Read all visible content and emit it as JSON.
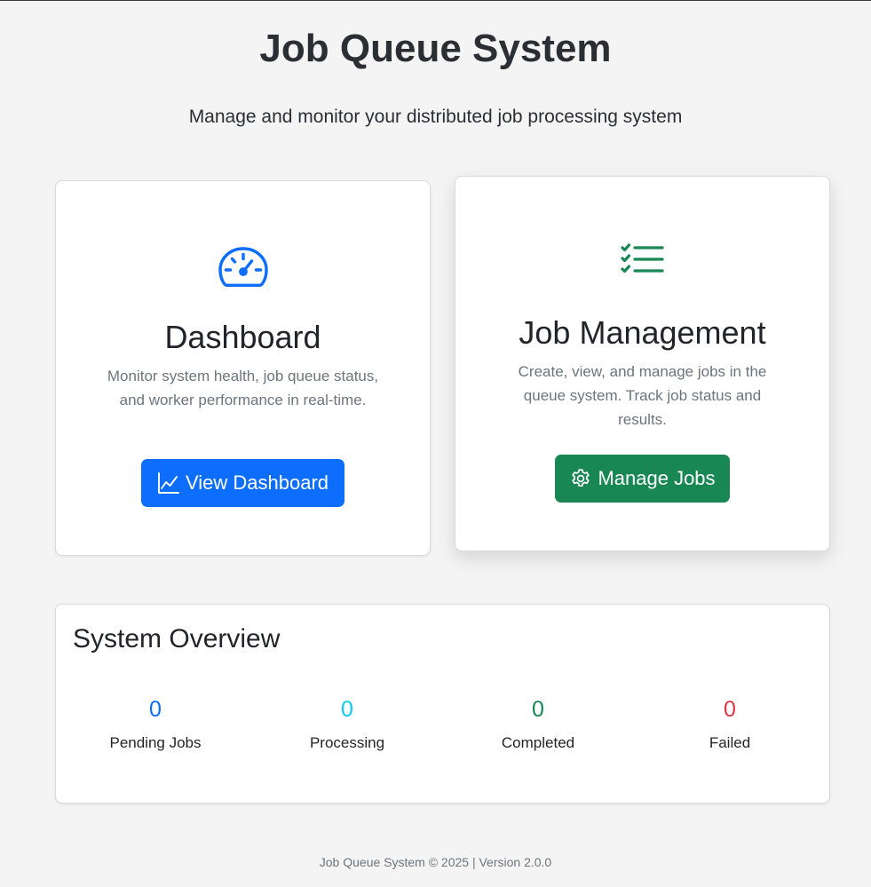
{
  "header": {
    "title": "Job Queue System",
    "subtitle": "Manage and monitor your distributed job processing system"
  },
  "cards": {
    "dashboard": {
      "icon": "speedometer-icon",
      "title": "Dashboard",
      "description": "Monitor system health, job queue status, and worker performance in real-time.",
      "button_label": "View Dashboard",
      "button_icon": "chart-line-icon",
      "accent": "#0d6efd"
    },
    "jobs": {
      "icon": "checklist-icon",
      "title": "Job Management",
      "description": "Create, view, and manage jobs in the queue system. Track job status and results.",
      "button_label": "Manage Jobs",
      "button_icon": "gear-icon",
      "accent": "#198754"
    }
  },
  "overview": {
    "title": "System Overview",
    "stats": [
      {
        "value": "0",
        "label": "Pending Jobs",
        "color": "#0d6efd"
      },
      {
        "value": "0",
        "label": "Processing",
        "color": "#0dcaf0"
      },
      {
        "value": "0",
        "label": "Completed",
        "color": "#198754"
      },
      {
        "value": "0",
        "label": "Failed",
        "color": "#dc3545"
      }
    ]
  },
  "footer": {
    "text": "Job Queue System © 2025 | Version 2.0.0"
  }
}
